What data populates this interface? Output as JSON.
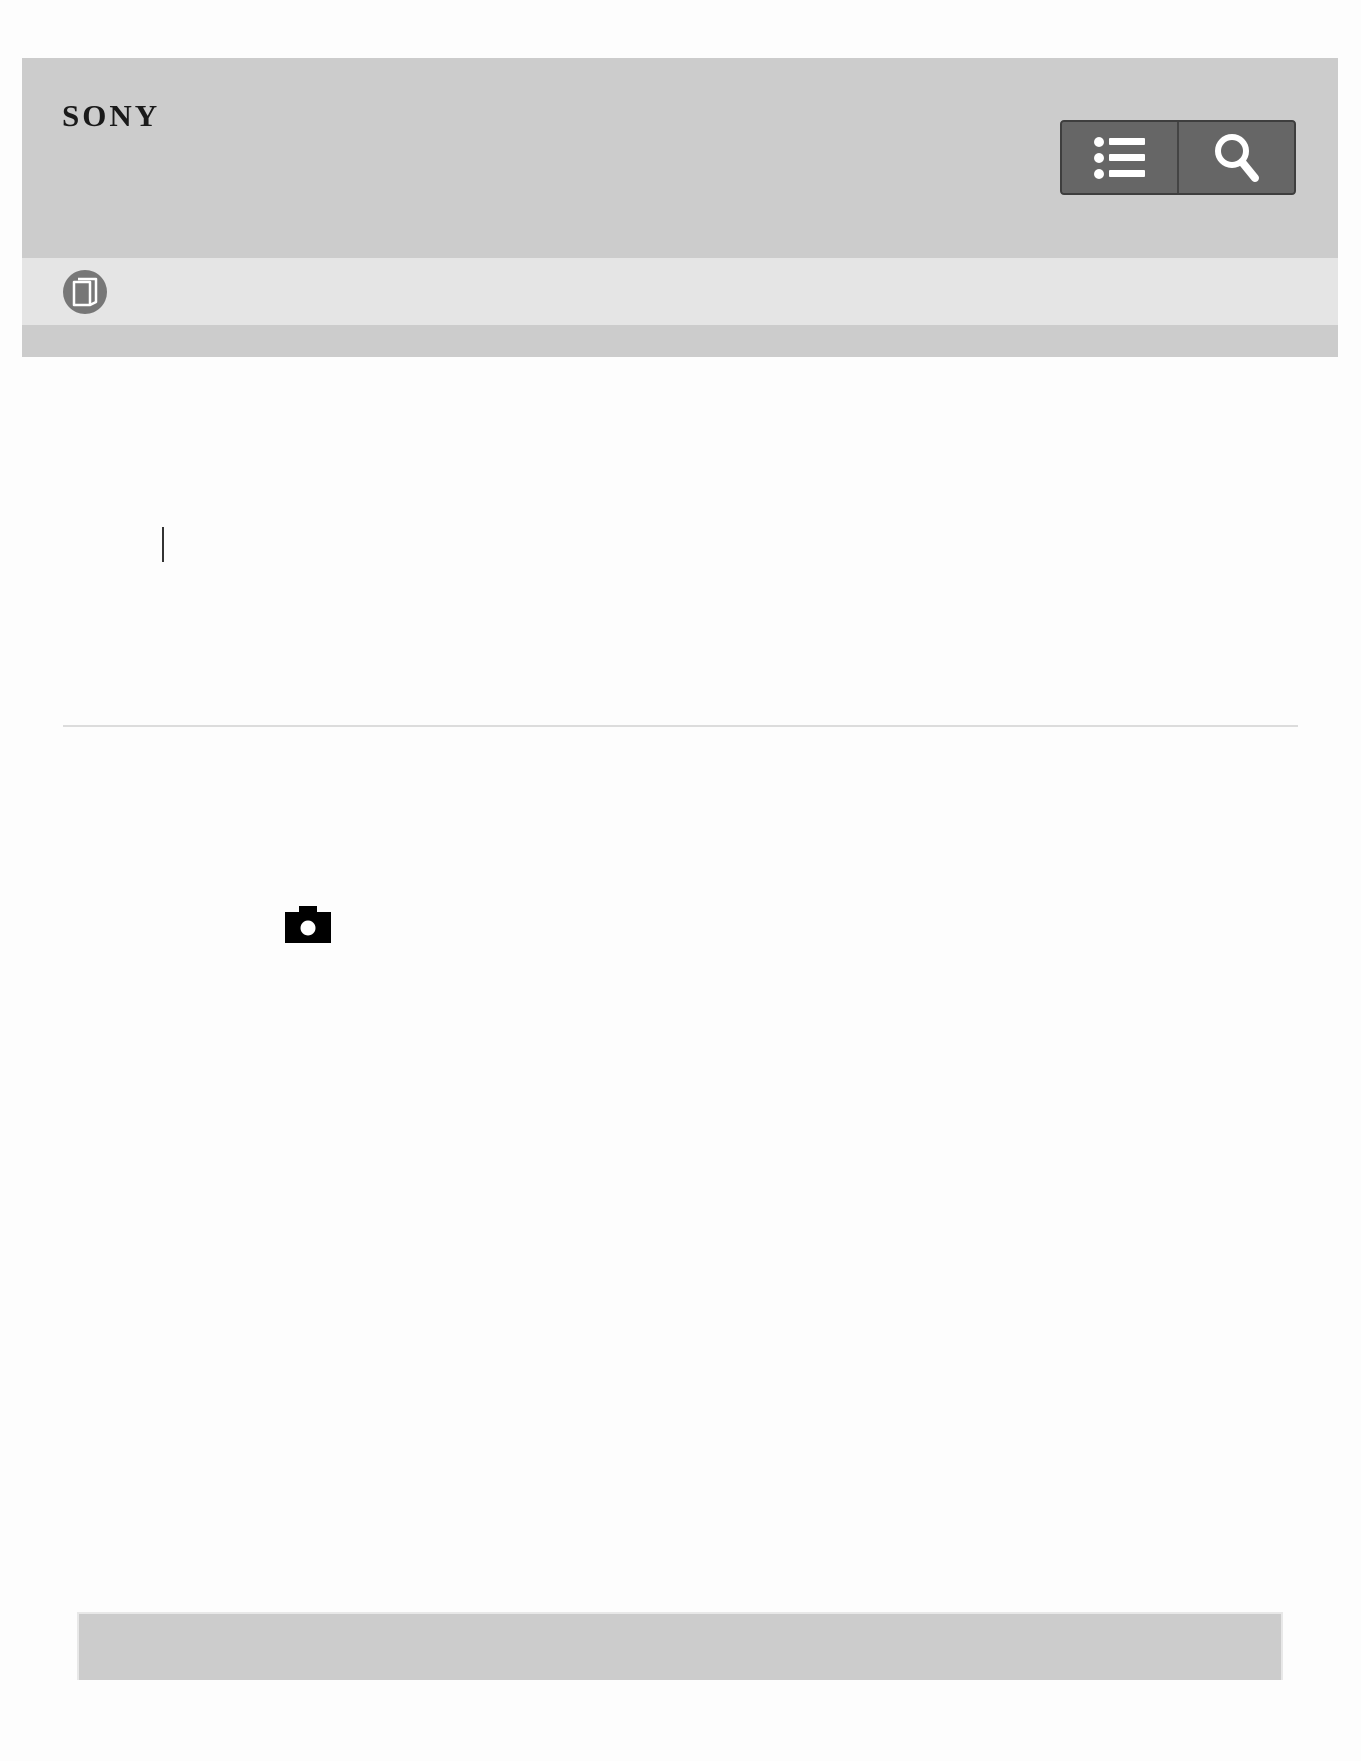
{
  "header": {
    "brand": "SONY",
    "menu_icon": "list-menu-icon",
    "search_icon": "search-icon"
  },
  "subbar": {
    "manual_icon": "manual-book-icon"
  },
  "content": {
    "camera_icon": "camera-icon"
  },
  "colors": {
    "header_bg": "#cccccc",
    "subbar_bg": "#e5e5e5",
    "button_bg": "#666666",
    "icon_fg": "#ffffff"
  }
}
